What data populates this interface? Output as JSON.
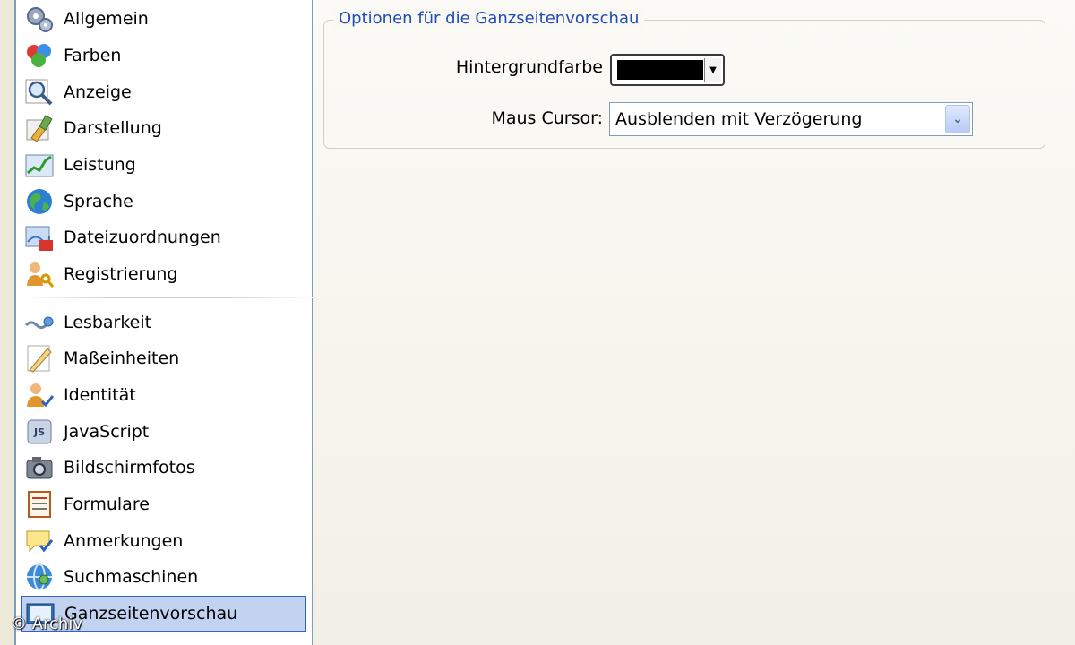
{
  "sidebar": {
    "items": [
      {
        "label": "Allgemein",
        "icon": "gears-icon"
      },
      {
        "label": "Farben",
        "icon": "color-balls-icon"
      },
      {
        "label": "Anzeige",
        "icon": "magnifier-icon"
      },
      {
        "label": "Darstellung",
        "icon": "brush-icon"
      },
      {
        "label": "Leistung",
        "icon": "performance-chart-icon"
      },
      {
        "label": "Sprache",
        "icon": "globe-icon"
      },
      {
        "label": "Dateizuordnungen",
        "icon": "file-association-icon"
      },
      {
        "label": "Registrierung",
        "icon": "users-key-icon"
      },
      {
        "label": "Lesbarkeit",
        "icon": "readability-icon"
      },
      {
        "label": "Maßeinheiten",
        "icon": "ruler-icon"
      },
      {
        "label": "Identität",
        "icon": "identity-user-icon"
      },
      {
        "label": "JavaScript",
        "icon": "javascript-icon"
      },
      {
        "label": "Bildschirmfotos",
        "icon": "camera-icon"
      },
      {
        "label": "Formulare",
        "icon": "form-icon"
      },
      {
        "label": "Anmerkungen",
        "icon": "comment-icon"
      },
      {
        "label": "Suchmaschinen",
        "icon": "search-engine-icon"
      },
      {
        "label": "Ganzseitenvorschau",
        "icon": "fullscreen-preview-icon",
        "selected": true
      }
    ]
  },
  "main": {
    "group_title": "Optionen für die Ganzseitenvorschau",
    "background_color_label": "Hintergrundfarbe",
    "background_color_value": "#000000",
    "mouse_cursor_label": "Maus Cursor:",
    "mouse_cursor_value": "Ausblenden mit Verzögerung"
  },
  "watermark": "© Archiv",
  "colors": {
    "selection_bg": "#c2d3f2",
    "selection_border": "#3163c5",
    "group_title": "#1f4bb5"
  }
}
